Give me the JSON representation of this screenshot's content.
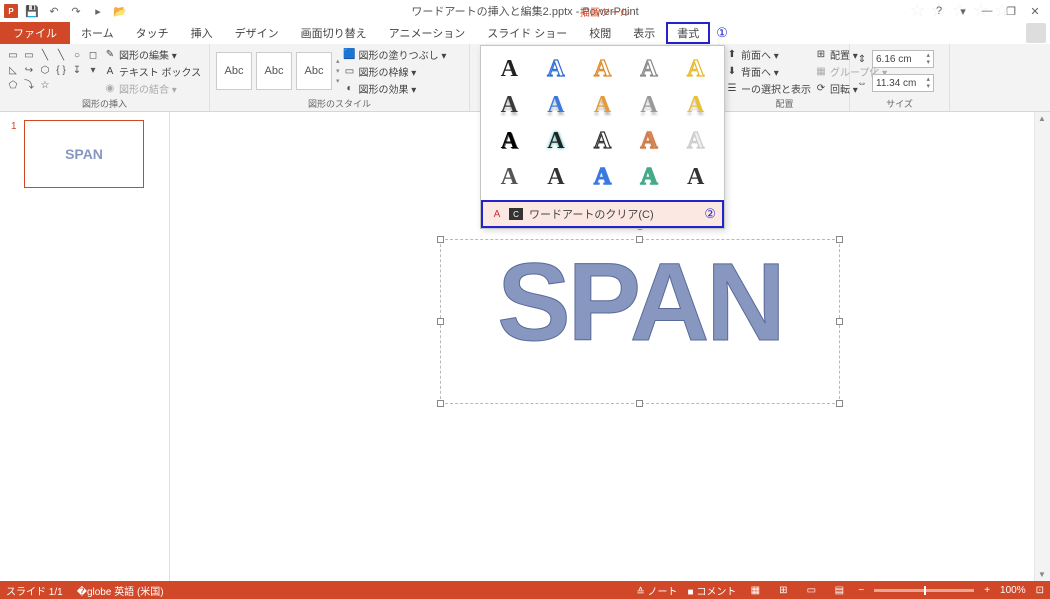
{
  "titlebar": {
    "title": "ワードアートの挿入と編集2.pptx - PowerPoint",
    "contextual": "描画ツール",
    "app_abbr": "P"
  },
  "qat": {
    "save": "💾",
    "undo": "↶",
    "redo": "↷",
    "start": "▸",
    "folder": "📂"
  },
  "winctrl": {
    "help": "?",
    "opts": "▾",
    "min": "—",
    "restore": "❐",
    "close": "✕"
  },
  "tabs": {
    "file": "ファイル",
    "home": "ホーム",
    "touch": "タッチ",
    "insert": "挿入",
    "design": "デザイン",
    "transitions": "画面切り替え",
    "animations": "アニメーション",
    "slideshow": "スライド ショー",
    "review": "校閲",
    "view": "表示",
    "format": "書式",
    "callout1": "①"
  },
  "ribbon": {
    "groups": {
      "insert_shapes": "図形の挿入",
      "shape_styles": "図形のスタイル",
      "arrange": "配置",
      "size": "サイズ"
    },
    "shape_cmds": {
      "edit": "図形の編集 ▾",
      "textbox": "テキスト ボックス",
      "merge": "図形の結合 ▾"
    },
    "style_cmds": {
      "fill": "図形の塗りつぶし ▾",
      "outline": "図形の枠線 ▾",
      "effects": "図形の効果 ▾"
    },
    "arrange_cmds": {
      "front": "前面へ ▾",
      "back": "背面へ ▾",
      "select": "ーの選択と表示",
      "align": "配置 ▾",
      "group": "グループ化 ▾",
      "rotate": "回転 ▾"
    },
    "size_vals": {
      "height": "6.16 cm",
      "width": "11.34 cm"
    },
    "sample": "Abc"
  },
  "wa_gallery": {
    "letter": "A",
    "clear_label": "ワードアートのクリア(C)",
    "clear_key": "C",
    "callout2": "②",
    "styles": [
      {
        "fill": "#222",
        "stroke": "none",
        "shadow": "none"
      },
      {
        "fill": "none",
        "stroke": "#2e6bd6",
        "shadow": "none"
      },
      {
        "fill": "none",
        "stroke": "#e08a2a",
        "shadow": "none"
      },
      {
        "fill": "none",
        "stroke": "#888",
        "shadow": "none"
      },
      {
        "fill": "none",
        "stroke": "#e7b92a",
        "shadow": "none"
      },
      {
        "fill": "#3a3a3a",
        "stroke": "none",
        "shadow": "0 3px 2px #bbb"
      },
      {
        "fill": "#3a79e0",
        "stroke": "none",
        "shadow": "0 3px 2px #bbb"
      },
      {
        "fill": "#e69a3a",
        "stroke": "none",
        "shadow": "0 3px 2px #bbb"
      },
      {
        "fill": "#999",
        "stroke": "none",
        "shadow": "0 3px 2px #ccc"
      },
      {
        "fill": "#e8c038",
        "stroke": "none",
        "shadow": "0 3px 2px #ccc"
      },
      {
        "fill": "#000",
        "stroke": "none",
        "shadow": "1px 1px 0 #555"
      },
      {
        "fill": "#222",
        "stroke": "none",
        "shadow": "0 0 3px #2aa"
      },
      {
        "fill": "#fff",
        "stroke": "#333",
        "shadow": "none"
      },
      {
        "fill": "none",
        "stroke": "#c74",
        "shadow": "0 0 2px #c74"
      },
      {
        "fill": "#eee",
        "stroke": "#ccc",
        "shadow": "none"
      },
      {
        "fill": "#555",
        "stroke": "none",
        "shadow": "none",
        "pattern": true
      },
      {
        "fill": "#333",
        "stroke": "none",
        "shadow": "none"
      },
      {
        "fill": "none",
        "stroke": "#3a79e0",
        "shadow": "none",
        "double": true
      },
      {
        "fill": "none",
        "stroke": "#4a8",
        "shadow": "none",
        "double": true
      },
      {
        "fill": "#333",
        "stroke": "none",
        "shadow": "none",
        "pattern": true
      }
    ]
  },
  "slide": {
    "num": "1",
    "thumb_text": "SPAN",
    "wa_text": "SPAN"
  },
  "status": {
    "slide": "スライド 1/1",
    "lang": "英語 (米国)",
    "notes": "≙ ノート",
    "comments": "■ コメント",
    "zoom": "100%"
  }
}
